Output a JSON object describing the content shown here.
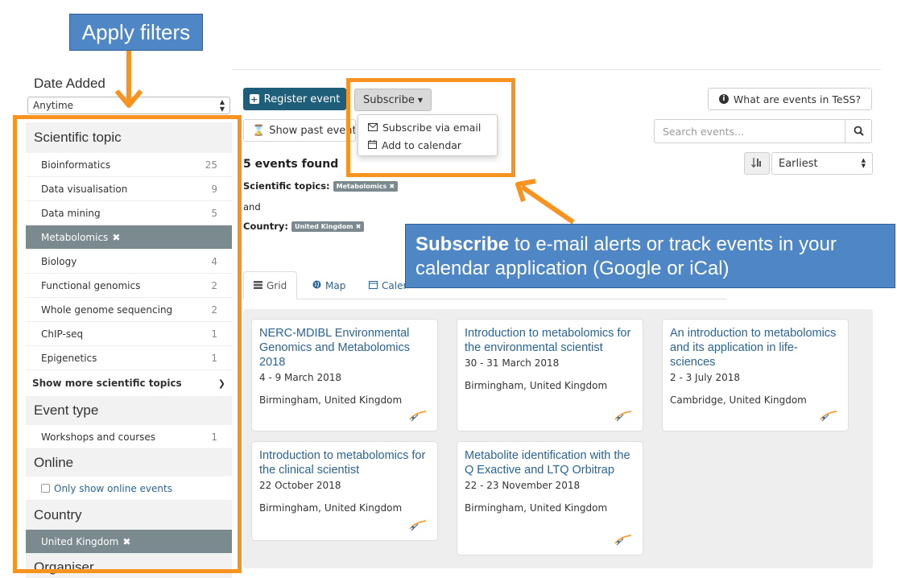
{
  "annotations": {
    "apply_filters": "Apply filters",
    "subscribe_bold": "Subscribe",
    "subscribe_rest": " to e-mail alerts or track events in your calendar application (Google or iCal)"
  },
  "sidebar": {
    "date_added": {
      "heading": "Date Added",
      "selected": "Anytime"
    },
    "scientific_topic": {
      "heading": "Scientific topic",
      "items": [
        {
          "label": "Bioinformatics",
          "count": "25"
        },
        {
          "label": "Data visualisation",
          "count": "9"
        },
        {
          "label": "Data mining",
          "count": "5"
        },
        {
          "label": "Metabolomics",
          "count": "",
          "active": true
        },
        {
          "label": "Biology",
          "count": "4"
        },
        {
          "label": "Functional genomics",
          "count": "2"
        },
        {
          "label": "Whole genome sequencing",
          "count": "2"
        },
        {
          "label": "ChIP-seq",
          "count": "1"
        },
        {
          "label": "Epigenetics",
          "count": "1"
        }
      ],
      "show_more": "Show more scientific topics"
    },
    "event_type": {
      "heading": "Event type",
      "items": [
        {
          "label": "Workshops and courses",
          "count": "1"
        }
      ]
    },
    "online": {
      "heading": "Online",
      "checkbox_label": "Only show online events"
    },
    "country": {
      "heading": "Country",
      "selected": "United Kingdom"
    },
    "organiser_partial": "Organiser"
  },
  "toolbar": {
    "register": "Register event",
    "subscribe": "Subscribe",
    "subscribe_menu": [
      "Subscribe via email",
      "Add to calendar"
    ],
    "show_past": "Show past events",
    "what_are": "What are events in TeSS?",
    "search_placeholder": "Search events...",
    "sort_selected": "Earliest"
  },
  "results": {
    "found": "5 events found",
    "topics_label": "Scientific topics:",
    "topics_tag": "Metabolomics",
    "and": "and",
    "country_label": "Country:",
    "country_tag": "United Kingdom"
  },
  "tabs": [
    {
      "label": "Grid",
      "icon": "grid-icon"
    },
    {
      "label": "Map",
      "icon": "globe-icon"
    },
    {
      "label": "Calendar",
      "icon": "calendar-icon"
    }
  ],
  "events": [
    {
      "title": "NERC-MDIBL Environmental Genomics and Metabolomics 2018",
      "date": "4 - 9 March 2018",
      "location": "Birmingham, United Kingdom"
    },
    {
      "title": "Introduction to metabolomics for the environmental scientist",
      "date": "30 - 31 March 2018",
      "location": "Birmingham, United Kingdom"
    },
    {
      "title": "An introduction to metabolomics and its application in life-sciences",
      "date": "2 - 3 July 2018",
      "location": "Cambridge, United Kingdom"
    },
    {
      "title": "Introduction to metabolomics for the clinical scientist",
      "date": "22 October 2018",
      "location": "Birmingham, United Kingdom"
    },
    {
      "title": "Metabolite identification with the Q Exactive and LTQ Orbitrap",
      "date": "22 - 23 November 2018",
      "location": "Birmingham, United Kingdom"
    }
  ],
  "colors": {
    "accent_orange": "#f7931e",
    "callout_blue": "#4f86c6",
    "primary_button": "#1e5e79",
    "link_blue": "#2a6496",
    "active_facet": "#7a8a8f"
  }
}
